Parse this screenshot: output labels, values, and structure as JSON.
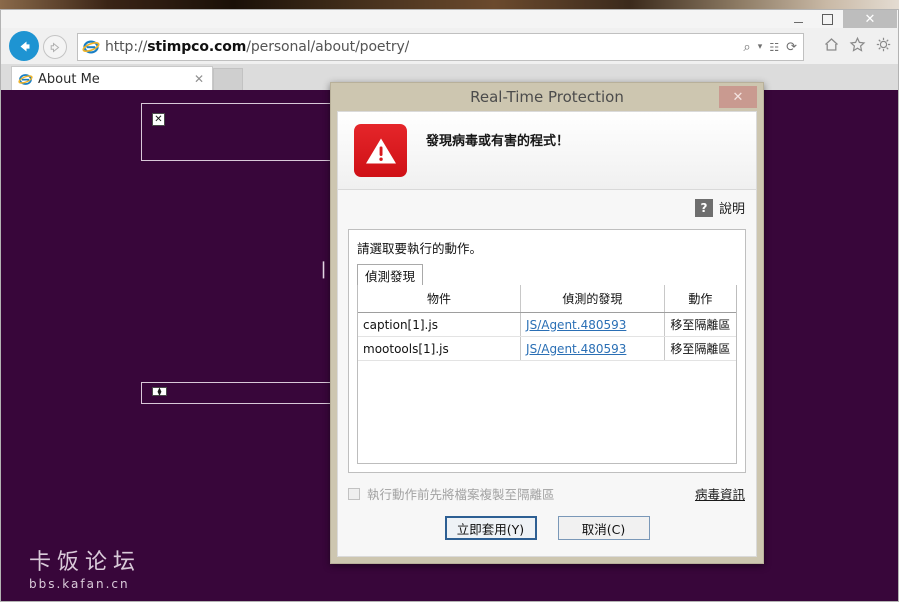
{
  "browser": {
    "window_controls": {
      "minimize": "–",
      "maximize": "□",
      "close": "✕"
    },
    "nav": {
      "back_icon": "back-arrow-icon",
      "forward_icon": "forward-arrow-icon"
    },
    "address": {
      "url_scheme": "http://",
      "url_host": "stimpco.com",
      "url_path": "/personal/about/poetry/",
      "favicon": "internet-explorer-icon",
      "tools": {
        "search": "⌕",
        "dropdown": "▾",
        "compat_view": "☷",
        "refresh": "⟳"
      }
    },
    "toolbar_icons": {
      "home": "home-icon",
      "favorites": "star-icon",
      "settings": "gear-icon"
    },
    "tab": {
      "title": "About Me",
      "close": "✕",
      "favicon": "internet-explorer-icon"
    },
    "new_tab_label": ""
  },
  "page": {
    "broken_image_glyph": "✕",
    "broken_image_glyph_2": "⧫",
    "caret_text": "⎸",
    "watermark_cn": "卡饭论坛",
    "watermark_url": "bbs.kafan.cn"
  },
  "dialog": {
    "title": "Real-Time Protection",
    "close_label": "✕",
    "warning_headline": "發現病毒或有害的程式！",
    "warning_icon": "warning-triangle-icon",
    "help_icon": "?",
    "help_label": "說明",
    "prompt": "請選取要執行的動作。",
    "tab_label": "偵測發現",
    "table": {
      "headers": [
        "物件",
        "偵測的發現",
        "動作"
      ],
      "rows": [
        {
          "object": "caption[1].js",
          "threat": "JS/Agent.480593",
          "action": "移至隔離區"
        },
        {
          "object": "mootools[1].js",
          "threat": "JS/Agent.480593",
          "action": "移至隔離區"
        }
      ]
    },
    "copy_checkbox_label": "執行動作前先將檔案複製至隔離區",
    "copy_checkbox_checked": false,
    "virus_info_link": "病毒資訊",
    "apply_button": "立即套用(Y)",
    "cancel_button": "取消(C)"
  },
  "colors": {
    "page_background": "#38063a",
    "dialog_frame": "#cdc6b0",
    "dialog_close": "#c99a90",
    "warning_red": "#d8181d",
    "link_blue": "#2a6fb5",
    "ie_blue": "#1e94d2"
  }
}
